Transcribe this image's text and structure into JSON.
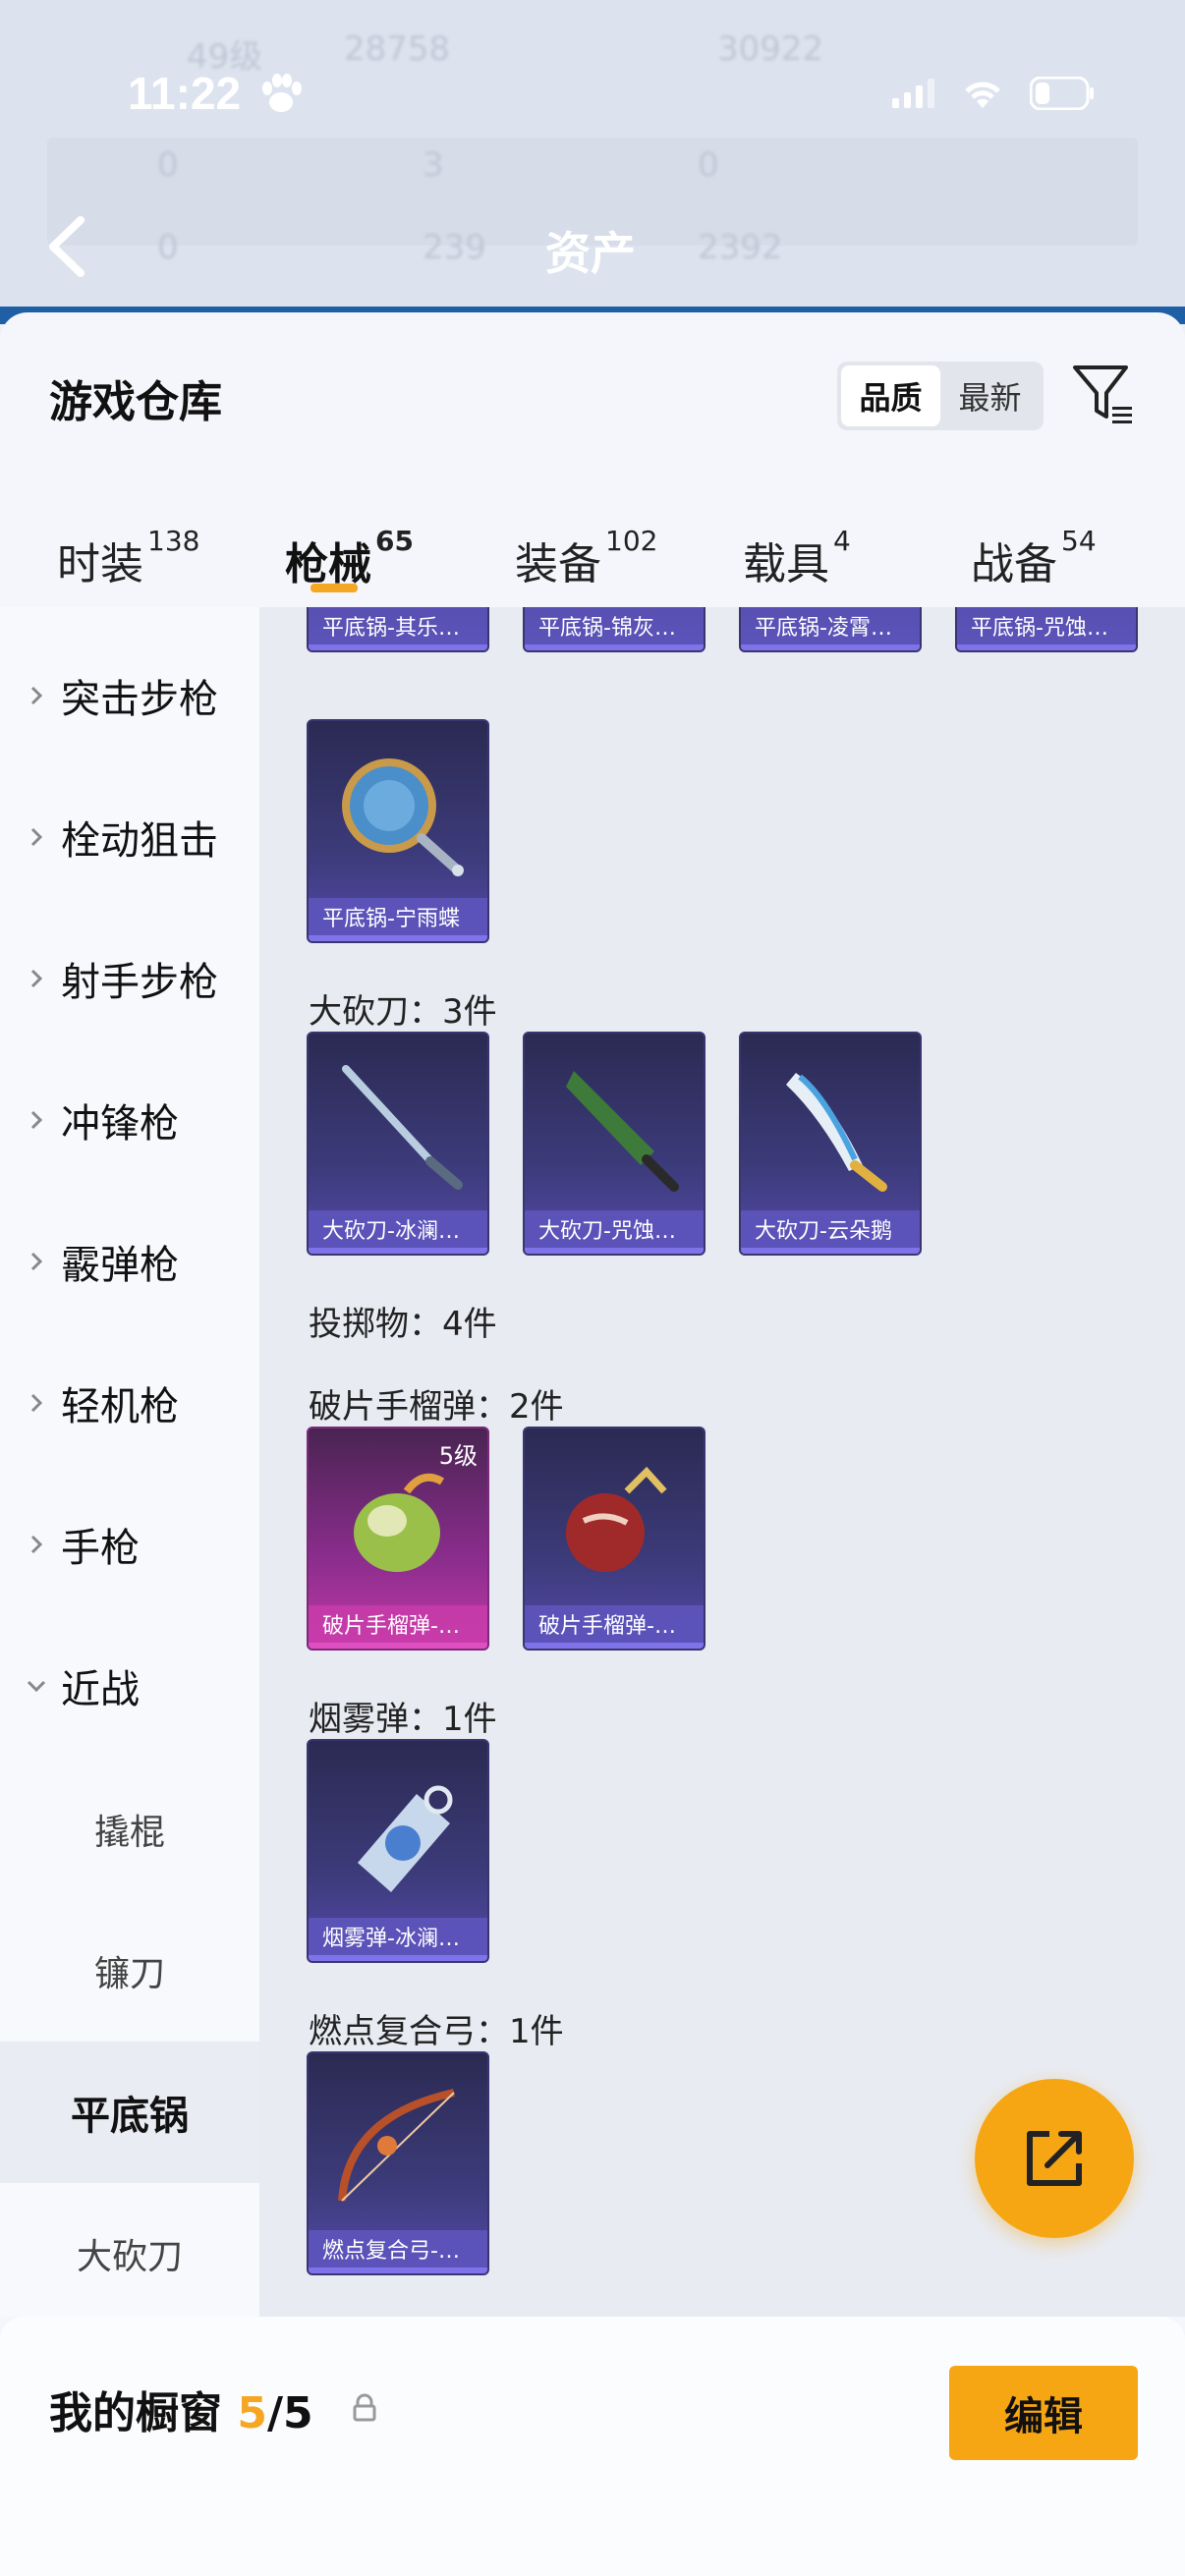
{
  "status_bar": {
    "time": "11:22"
  },
  "background": {
    "title": "资产",
    "ghost_texts": [
      "49级",
      "28758",
      "30922",
      "0",
      "3",
      "0",
      "0",
      "239",
      "2392"
    ]
  },
  "header": {
    "title": "游戏仓库",
    "sort_options": [
      "品质",
      "最新"
    ],
    "sort_selected": "品质"
  },
  "tabs": [
    {
      "label": "时装",
      "count": "138"
    },
    {
      "label": "枪械",
      "count": "65",
      "active": true
    },
    {
      "label": "装备",
      "count": "102"
    },
    {
      "label": "载具",
      "count": "4"
    },
    {
      "label": "战备",
      "count": "54"
    }
  ],
  "categories": [
    {
      "label": "突击步枪"
    },
    {
      "label": "栓动狙击"
    },
    {
      "label": "射手步枪"
    },
    {
      "label": "冲锋枪"
    },
    {
      "label": "霰弹枪"
    },
    {
      "label": "轻机枪"
    },
    {
      "label": "手枪"
    },
    {
      "label": "近战",
      "expanded": true
    }
  ],
  "subcategories": [
    {
      "label": "撬棍"
    },
    {
      "label": "镰刀"
    },
    {
      "label": "平底锅",
      "active": true
    },
    {
      "label": "大砍刀"
    }
  ],
  "content": {
    "top_row_items": [
      "平底锅-其乐…",
      "平底锅-锦灰…",
      "平底锅-凌霄…",
      "平底锅-咒蚀…"
    ],
    "pan_item": "平底锅-宁雨蝶",
    "sections": [
      {
        "label": "大砍刀：3件",
        "items": [
          "大砍刀-冰澜…",
          "大砍刀-咒蚀…",
          "大砍刀-云朵鹅"
        ]
      },
      {
        "label": "投掷物：4件"
      },
      {
        "label": "破片手榴弹：2件",
        "items": [
          "破片手榴弹-…",
          "破片手榴弹-…"
        ],
        "first_item_level": "5级"
      },
      {
        "label": "烟雾弹：1件",
        "items": [
          "烟雾弹-冰澜…"
        ]
      },
      {
        "label": "燃点复合弓：1件",
        "items": [
          "燃点复合弓-…"
        ]
      }
    ]
  },
  "bottom_bar": {
    "title": "我的橱窗",
    "count_current": "5",
    "count_sep": "/",
    "count_total": "5",
    "edit_label": "编辑"
  },
  "colors": {
    "accent": "#f6a613",
    "item_purple": "#5449a8",
    "item_pink": "#c13aa4"
  }
}
